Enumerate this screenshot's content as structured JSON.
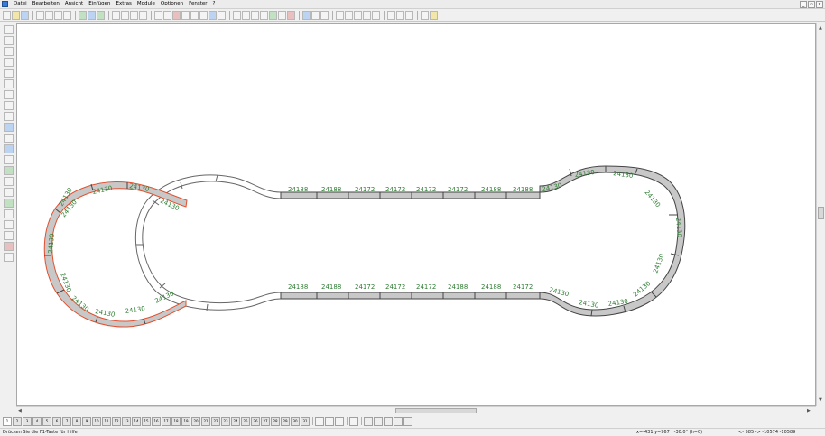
{
  "menu": {
    "items": [
      "Datei",
      "Bearbeiten",
      "Ansicht",
      "Einfügen",
      "Extras",
      "Module",
      "Optionen",
      "Fenster",
      "?"
    ]
  },
  "window_controls": [
    "_",
    "▫",
    "x"
  ],
  "track_labels": {
    "straight_top": [
      "24188",
      "24188",
      "24172",
      "24172",
      "24172",
      "24172",
      "24188",
      "24188"
    ],
    "straight_bottom": [
      "24188",
      "24188",
      "24172",
      "24172",
      "24172",
      "24188",
      "24188",
      "24172"
    ],
    "right_loop": [
      "24130",
      "24130",
      "24130",
      "24130",
      "24130",
      "24130",
      "24130",
      "24130",
      "24130",
      "24130"
    ],
    "left_loop": [
      "24130",
      "24130",
      "24130",
      "24130",
      "24130",
      "24130",
      "24130",
      "24130",
      "24130",
      "24130",
      "24130"
    ]
  },
  "page_tabs": [
    "1",
    "2",
    "3",
    "4",
    "5",
    "6",
    "7",
    "8",
    "9",
    "10",
    "11",
    "12",
    "13",
    "14",
    "15",
    "16",
    "17",
    "18",
    "19",
    "20",
    "21",
    "22",
    "23",
    "24",
    "25",
    "26",
    "27",
    "28",
    "29",
    "30",
    "31"
  ],
  "status": {
    "help_text": "Drücken Sie die F1-Taste für Hilfe",
    "coords_left": "x=-431  y=967 | -30.0° (h=0)",
    "coords_right": "<- 585 ->    -10574   -10589"
  },
  "colors": {
    "track_label": "#2e7d32",
    "selected_track": "#e05030",
    "gray_track_fill": "#c8c8c8",
    "canvas_bg": "#ffffff",
    "chrome_bg": "#f0f0f0"
  }
}
